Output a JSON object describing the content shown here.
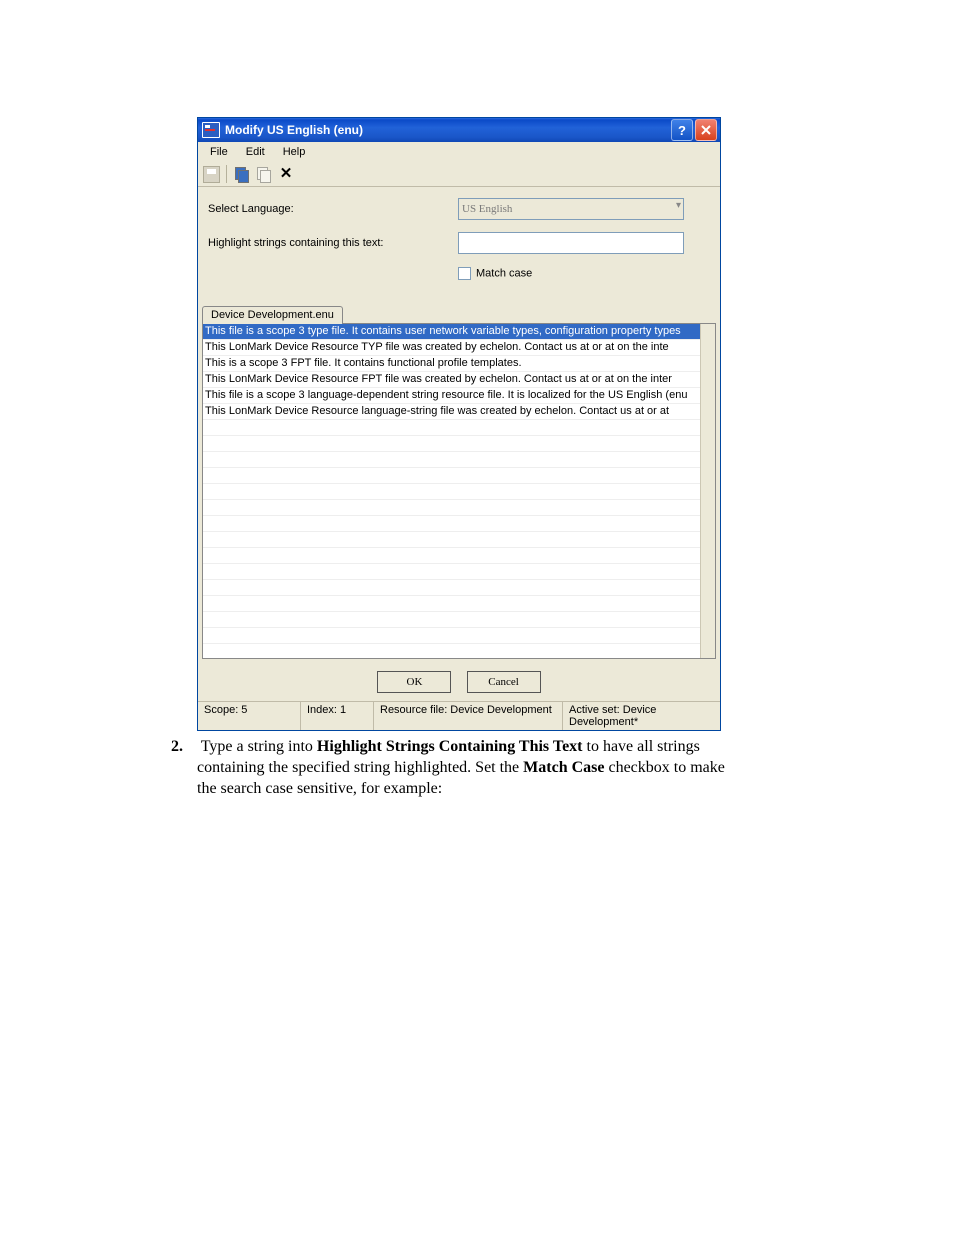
{
  "window": {
    "title": "Modify US English (enu)"
  },
  "menubar": {
    "file": "File",
    "edit": "Edit",
    "help": "Help"
  },
  "form": {
    "select_language_label": "Select Language:",
    "select_language_value": "US English",
    "highlight_label": "Highlight strings containing this text:",
    "highlight_value": "",
    "match_case_label": "Match case",
    "tab_label": "Device Development.enu"
  },
  "list": {
    "rows": [
      "This file is a scope 3 type file. It contains user network variable types, configuration property types",
      "This LonMark Device Resource TYP file was created by echelon. Contact us at  or at  on the inte",
      "This is a scope 3 FPT file. It contains functional profile templates.",
      "This LonMark Device Resource FPT file was created by echelon. Contact us at  or at  on the inter",
      "This file is a scope 3 language-dependent string resource file. It is localized for the US English (enu",
      "This LonMark Device Resource language-string file was created by echelon. Contact us at  or at"
    ]
  },
  "buttons": {
    "ok": "OK",
    "cancel": "Cancel"
  },
  "status": {
    "scope": "Scope: 5",
    "index": "Index: 1",
    "resource": "Resource file: Device Development",
    "active": "Active set: Device Development*"
  },
  "body": {
    "step_num": "2.",
    "line1_a": "Type a string into ",
    "line1_b": "Highlight Strings Containing This Text",
    "line1_c": " to have all strings",
    "line2_a": "containing the specified string highlighted.  Set the ",
    "line2_b": "Match Case",
    "line2_c": " checkbox to make",
    "line3": "the search case sensitive, for example:"
  }
}
